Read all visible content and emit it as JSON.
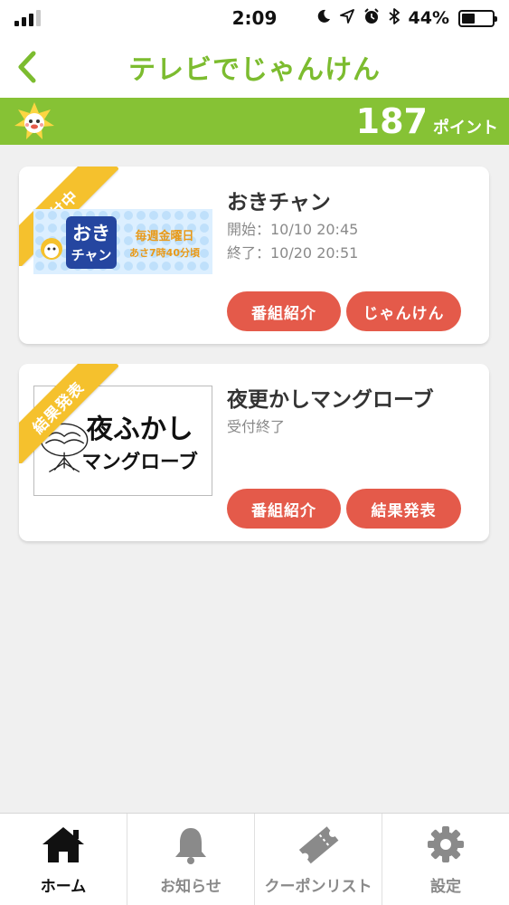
{
  "status_bar": {
    "time": "2:09",
    "battery": "44%",
    "battery_level": 0.44,
    "icons": [
      "moon-icon",
      "location-arrow-icon",
      "alarm-icon",
      "bluetooth-icon"
    ]
  },
  "nav": {
    "title": "テレビでじゃんけん",
    "back_icon": "chevron-left-icon",
    "accent": "#7cbc2f"
  },
  "points": {
    "value": "187",
    "unit": "ポイント",
    "bar_color": "#86c235"
  },
  "cards": [
    {
      "ribbon": "受付中",
      "thumb_texts": [
        "おき",
        "チャン",
        "毎週金曜日",
        "あさ7時40分頃"
      ],
      "title": "おきチャン",
      "start": "開始：10/10 20:45",
      "end": "終了：10/20 20:51",
      "buttons": [
        "番組紹介",
        "じゃんけん"
      ]
    },
    {
      "ribbon": "結果発表",
      "thumb_texts": [
        "夜ふかし",
        "マングローブ"
      ],
      "title": "夜更かしマングローブ",
      "status": "受付終了",
      "buttons": [
        "番組紹介",
        "結果発表"
      ]
    }
  ],
  "tabs": [
    {
      "label": "ホーム",
      "icon": "home-icon",
      "active": true
    },
    {
      "label": "お知らせ",
      "icon": "bell-icon",
      "active": false
    },
    {
      "label": "クーポンリスト",
      "icon": "ticket-icon",
      "active": false
    },
    {
      "label": "設定",
      "icon": "gear-icon",
      "active": false
    }
  ],
  "colors": {
    "button": "#e45a4a",
    "ribbon": "#f5c12d"
  }
}
